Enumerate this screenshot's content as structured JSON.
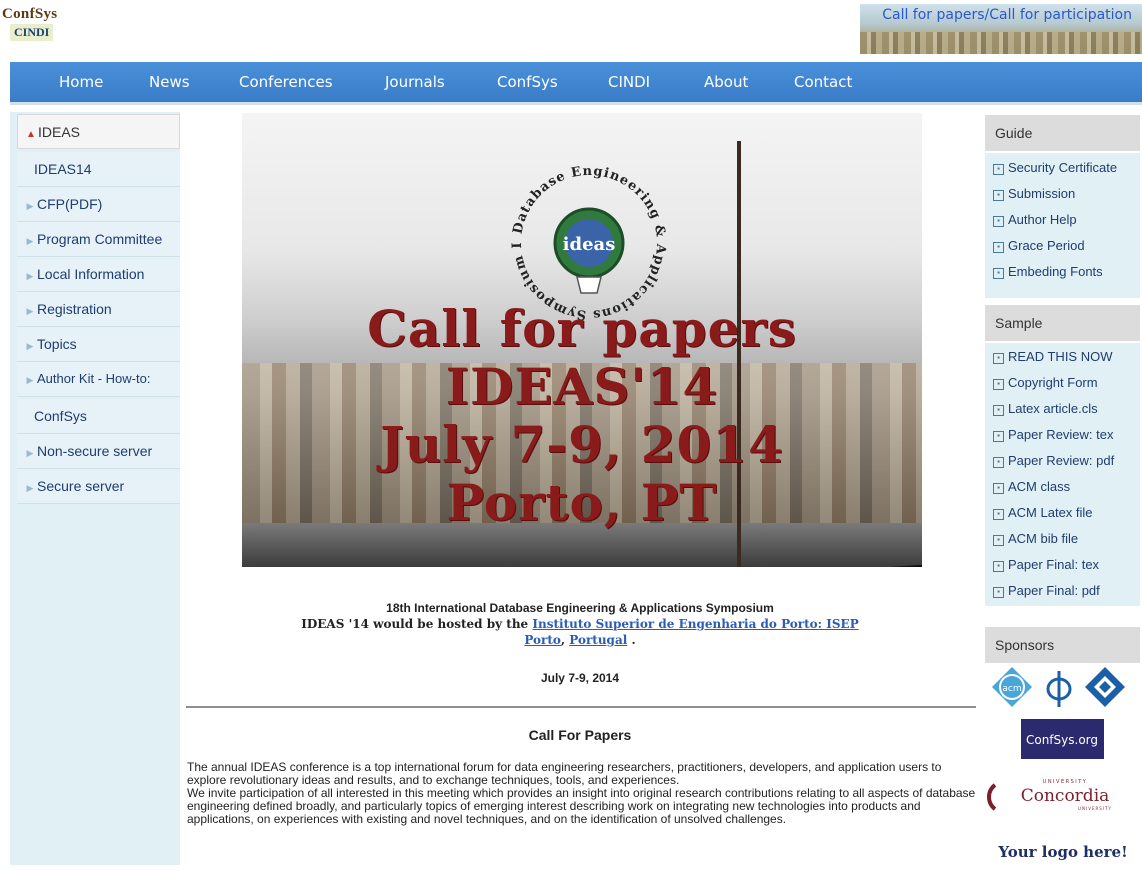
{
  "header": {
    "logo_line1": "ConfSys",
    "logo_line2": "CINDI",
    "banner_text": "Call for papers/Call for participation"
  },
  "nav": {
    "items": [
      "Home",
      "News",
      "Conferences",
      "Journals",
      "ConfSys",
      "CINDI",
      "About",
      "Contact"
    ]
  },
  "sidebar": {
    "items": [
      {
        "label": "IDEAS"
      },
      {
        "label": "IDEAS14"
      },
      {
        "label": "CFP(PDF)"
      },
      {
        "label": "Program Committee"
      },
      {
        "label": "Local Information"
      },
      {
        "label": "Registration"
      },
      {
        "label": "Topics"
      },
      {
        "label": "Author Kit - How-to:"
      },
      {
        "label": "ConfSys"
      },
      {
        "label": "Non-secure server"
      },
      {
        "label": "Secure server"
      }
    ]
  },
  "hero": {
    "emblem_ring": "Database Engineering & Applications Symposium International",
    "emblem_center": "ideas",
    "line1": "Call for papers",
    "line2": "IDEAS'14",
    "line3": "July 7-9, 2014",
    "line4": "Porto, PT"
  },
  "intro": {
    "line1": "18th International Database Engineering & Applications Symposium",
    "line2_prefix": "IDEAS '14 would be hosted by the",
    "link_host": "Instituto Superior de Engenharia do Porto: ISEP",
    "link_city": "Porto",
    "link_country": "Portugal",
    "date": "July 7-9, 2014"
  },
  "cfp": {
    "title": "Call For Papers",
    "para1": "The annual IDEAS conference is a top international forum for data engineering researchers, practitioners, developers, and application users to explore revolutionary ideas and results, and to exchange techniques, tools, and experiences.",
    "para2": "We invite participation of all interested in this meeting which provides an insight into original research contributions relating to all aspects of database engineering defined broadly, and particularly topics of emerging interest describing work on integrating new technologies into products and applications, on experiences with existing and novel techniques, and on the identification of unsolved challenges."
  },
  "guide": {
    "title": "Guide",
    "items": [
      "Security Certificate",
      "Submission",
      "Author Help",
      "Grace Period",
      "Embeding Fonts"
    ]
  },
  "sample": {
    "title": "Sample",
    "items": [
      "READ THIS NOW",
      "Copyright Form",
      "Latex article.cls",
      "Paper Review: tex",
      "Paper Review: pdf",
      "ACM class",
      "ACM Latex file",
      "ACM bib file",
      "Paper Final: tex",
      "Paper Final: pdf"
    ]
  },
  "sponsors": {
    "title": "Sponsors",
    "acm_label": "acm",
    "confsys_label": "ConfSys.org",
    "concordia_top": "UNIVERSITY",
    "concordia_name": "Concordia",
    "concordia_bottom": "UNIVERSITY",
    "your_logo": "Your logo here!"
  }
}
